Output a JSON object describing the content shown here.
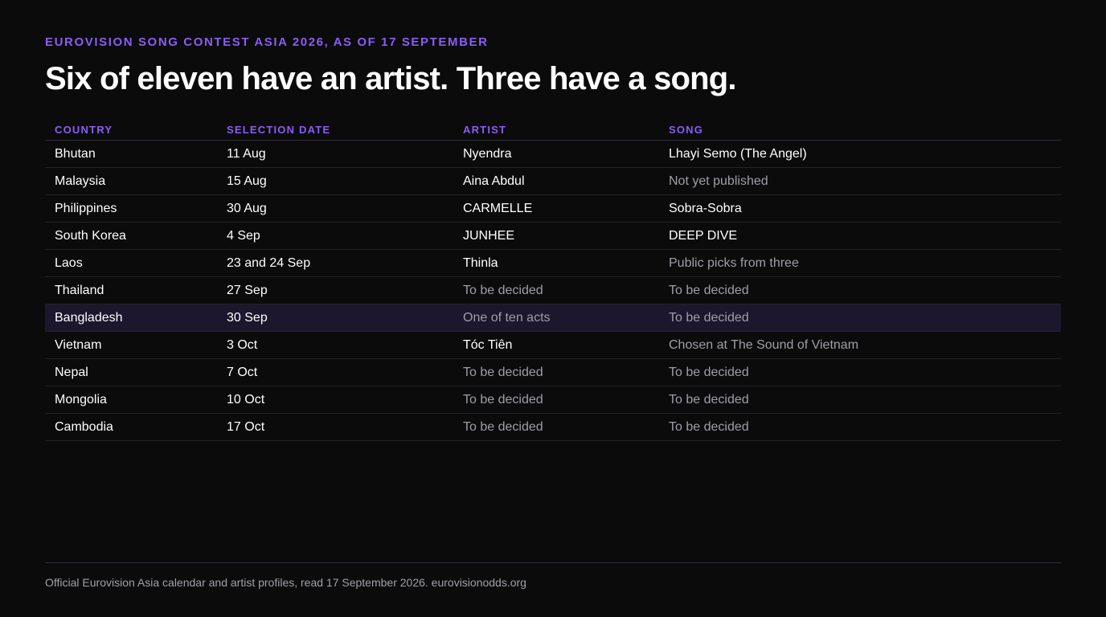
{
  "kicker": "EUROVISION SONG CONTEST ASIA 2026, AS OF 17 SEPTEMBER",
  "headline": "Six of eleven have an artist. Three have a song.",
  "table": {
    "headers": [
      "COUNTRY",
      "SELECTION DATE",
      "ARTIST",
      "SONG"
    ],
    "rows": [
      {
        "country": "Bhutan",
        "date": "11 Aug",
        "artist": "Nyendra",
        "song": "Lhayi Semo (The Angel)"
      },
      {
        "country": "Malaysia",
        "date": "15 Aug",
        "artist": "Aina Abdul",
        "song": "Not yet published"
      },
      {
        "country": "Philippines",
        "date": "30 Aug",
        "artist": "CARMELLE",
        "song": "Sobra-Sobra"
      },
      {
        "country": "South Korea",
        "date": "4 Sep",
        "artist": "JUNHEE",
        "song": "DEEP DIVE"
      },
      {
        "country": "Laos",
        "date": "23 and 24 Sep",
        "artist": "Thinla",
        "song": "Public picks from three"
      },
      {
        "country": "Thailand",
        "date": "27 Sep",
        "artist": "To be decided",
        "song": "To be decided"
      },
      {
        "country": "Bangladesh",
        "date": "30 Sep",
        "artist": "One of ten acts",
        "song": "To be decided"
      },
      {
        "country": "Vietnam",
        "date": "3 Oct",
        "artist": "Tóc Tiên",
        "song": "Chosen at The Sound of Vietnam"
      },
      {
        "country": "Nepal",
        "date": "7 Oct",
        "artist": "To be decided",
        "song": "To be decided"
      },
      {
        "country": "Mongolia",
        "date": "10 Oct",
        "artist": "To be decided",
        "song": "To be decided"
      },
      {
        "country": "Cambodia",
        "date": "17 Oct",
        "artist": "To be decided",
        "song": "To be decided"
      }
    ]
  },
  "footer": "Official Eurovision Asia calendar and artist profiles, read 17 September 2026. eurovisionodds.org",
  "colors": {
    "background": "#0b0b0c",
    "accent": "#8b5cf6",
    "text": "#ffffff",
    "muted_text": "#9e9ea7",
    "highlight_row": "#1c172d"
  }
}
